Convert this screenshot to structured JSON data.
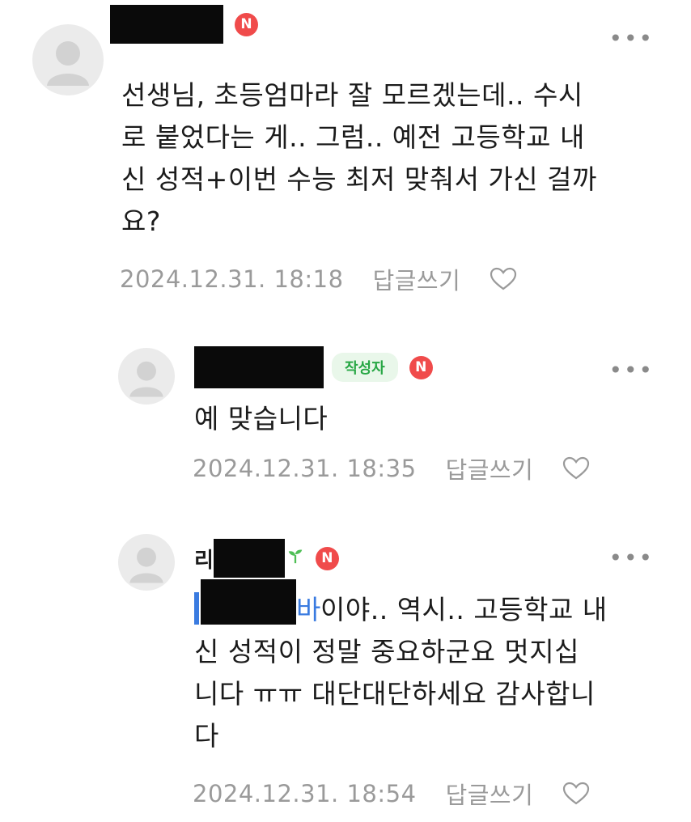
{
  "comments": [
    {
      "author_visible": "",
      "text": "선생님, 초등엄마라 잘 모르겠는데.. 수시로 붙었다는 게.. 그럼.. 예전 고등학교 내신 성적+이번 수능 최저 맞춰서 가신 걸까요?",
      "lines": [
        "선생님, 초등엄마라 잘 모르겠는데.. 수시",
        "로 붙었다는 게.. 그럼.. 예전 고등학교 내",
        "신 성적+이번 수능 최저 맞춰서 가신 걸까",
        "요?"
      ],
      "timestamp": "2024.12.31. 18:18",
      "reply_label": "답글쓰기",
      "badge_n": "N"
    },
    {
      "author_badge": "작성자",
      "text": "예 맞습니다",
      "timestamp": "2024.12.31. 18:35",
      "reply_label": "답글쓰기",
      "badge_n": "N"
    },
    {
      "author_visible_prefix": "리",
      "mention_end": "바",
      "lines": [
        "이야.. 역시.. 고등학교 내",
        "신 성적이 정말 중요하군요 멋지십",
        "니다 ㅠㅠ 대단대단하세요 감사합니",
        "다"
      ],
      "timestamp": "2024.12.31. 18:54",
      "reply_label": "답글쓰기",
      "badge_n": "N"
    }
  ],
  "icons": {
    "more": "more-dots-icon",
    "heart": "heart-outline-icon",
    "avatar": "default-avatar-icon",
    "sprout": "sprout-icon"
  },
  "colors": {
    "badge_red": "#f04b4b",
    "author_badge_green": "#28a745",
    "meta_gray": "#9a9a9a",
    "mention_blue": "#3a7be0"
  }
}
